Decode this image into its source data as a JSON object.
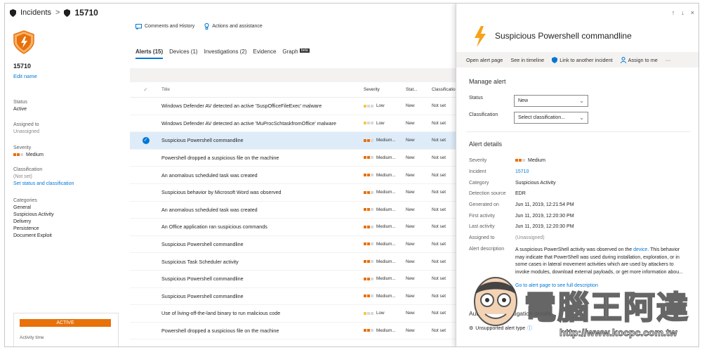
{
  "breadcrumb": {
    "root": "Incidents",
    "separator": ">",
    "current": "15710"
  },
  "incident": {
    "title": "15710",
    "edit_name": "Edit name",
    "status_label": "Status",
    "status_value": "Active",
    "assigned_label": "Assigned to",
    "assigned_value": "Unassigned",
    "severity_label": "Severity",
    "severity_value": "Medium",
    "classification_label": "Classification",
    "classification_value": "(Not set)",
    "set_status_link": "Set status and classification",
    "categories_label": "Categories",
    "categories": [
      "General",
      "Suspicious Activity",
      "Delivery",
      "Persistence",
      "Document Exploit"
    ],
    "active_badge": "ACTIVE",
    "activity_time_label": "Activity time"
  },
  "toolbar": {
    "comments": "Comments and History",
    "actions": "Actions and assistance"
  },
  "tabs": [
    {
      "label": "Alerts (15)"
    },
    {
      "label": "Devices (1)"
    },
    {
      "label": "Investigations (2)"
    },
    {
      "label": "Evidence"
    },
    {
      "label": "Graph"
    }
  ],
  "graph_badge": "beta",
  "table": {
    "columns": {
      "title": "Title",
      "severity": "Severity",
      "status": "Stat...",
      "classification": "Classification"
    },
    "rows": [
      {
        "title": "Windows Defender AV detected an active 'SuspOfficeFileExec' malware",
        "severity": "Low",
        "status": "New",
        "classification": "Not set"
      },
      {
        "title": "Windows Defender AV detected an active 'MuProcSchtaskfromOffice' malware",
        "severity": "Low",
        "status": "New",
        "classification": "Not set"
      },
      {
        "title": "Suspicious Powershell commandline",
        "severity": "Medium...",
        "status": "New",
        "classification": "Not set"
      },
      {
        "title": "Powershell dropped a suspicious file on the machine",
        "severity": "Medium...",
        "status": "New",
        "classification": "Not set"
      },
      {
        "title": "An anomalous scheduled task was created",
        "severity": "Medium...",
        "status": "New",
        "classification": "Not set"
      },
      {
        "title": "Suspicious behavior by Microsoft Word was observed",
        "severity": "Medium...",
        "status": "New",
        "classification": "Not set"
      },
      {
        "title": "An anomalous scheduled task was created",
        "severity": "Medium...",
        "status": "New",
        "classification": "Not set"
      },
      {
        "title": "An Office application ran suspicious commands",
        "severity": "Medium...",
        "status": "New",
        "classification": "Not set"
      },
      {
        "title": "Suspicious Powershell commandline",
        "severity": "Medium...",
        "status": "New",
        "classification": "Not set"
      },
      {
        "title": "Suspicious Task Scheduler activity",
        "severity": "Medium...",
        "status": "New",
        "classification": "Not set"
      },
      {
        "title": "Suspicious Powershell commandline",
        "severity": "Medium...",
        "status": "New",
        "classification": "Not set"
      },
      {
        "title": "Suspicious Powershell commandline",
        "severity": "Medium...",
        "status": "New",
        "classification": "Not set"
      },
      {
        "title": "Use of living-off-the-land binary to run malicious code",
        "severity": "Low",
        "status": "New",
        "classification": "Not set"
      },
      {
        "title": "Powershell dropped a suspicious file on the machine",
        "severity": "Medium...",
        "status": "New",
        "classification": "Not set"
      }
    ]
  },
  "panel": {
    "title": "Suspicious Powershell commandline",
    "nav": {
      "up": "↑",
      "down": "↓",
      "close": "×"
    },
    "actions": {
      "open": "Open alert page",
      "timeline": "See in timeline",
      "link": "Link to another incident",
      "assign": "Assign to me",
      "more": "···"
    },
    "manage_title": "Manage alert",
    "status_label": "Status",
    "status_value": "New",
    "classification_label": "Classification",
    "classification_placeholder": "Select classification...",
    "details_title": "Alert details",
    "details": {
      "severity_k": "Severity",
      "severity_v": "Medium",
      "incident_k": "Incident",
      "incident_v": "15710",
      "category_k": "Category",
      "category_v": "Suspicious Activity",
      "source_k": "Detection source",
      "source_v": "EDR",
      "generated_k": "Generated on",
      "generated_v": "Jun 11, 2019, 12:21:54 PM",
      "first_k": "First activity",
      "first_v": "Jun 11, 2019, 12:20:30 PM",
      "last_k": "Last activity",
      "last_v": "Jun 11, 2019, 12:20:30 PM",
      "assigned_k": "Assigned to",
      "assigned_v": "(Unassigned)"
    },
    "desc_label": "Alert description",
    "desc_text": "A suspicious PowerShell activity was observed on the",
    "desc_link": "device",
    "desc_rest": ". This behavior may indicate that PowerShell was used during installation, exploration, or in some cases in lateral movement activities which are used by attackers to invoke modules, download external payloads, or get more information abou...",
    "desc_more": "Go to alert page to see full description",
    "auto_title": "Automated investigation details",
    "unsupported": "Unsupported alert type"
  },
  "watermark": {
    "text": "電腦王阿達",
    "url": "http://www.kocpc.com.tw"
  },
  "colors": {
    "accent": "#0078d4",
    "orange": "#e8710a",
    "low": "#f2c94c"
  },
  "icons": [
    "shield-icon",
    "comment-icon",
    "lightbulb-icon",
    "bolt-icon",
    "link-shield-icon",
    "person-icon",
    "check-icon",
    "gear-icon",
    "info-icon"
  ]
}
